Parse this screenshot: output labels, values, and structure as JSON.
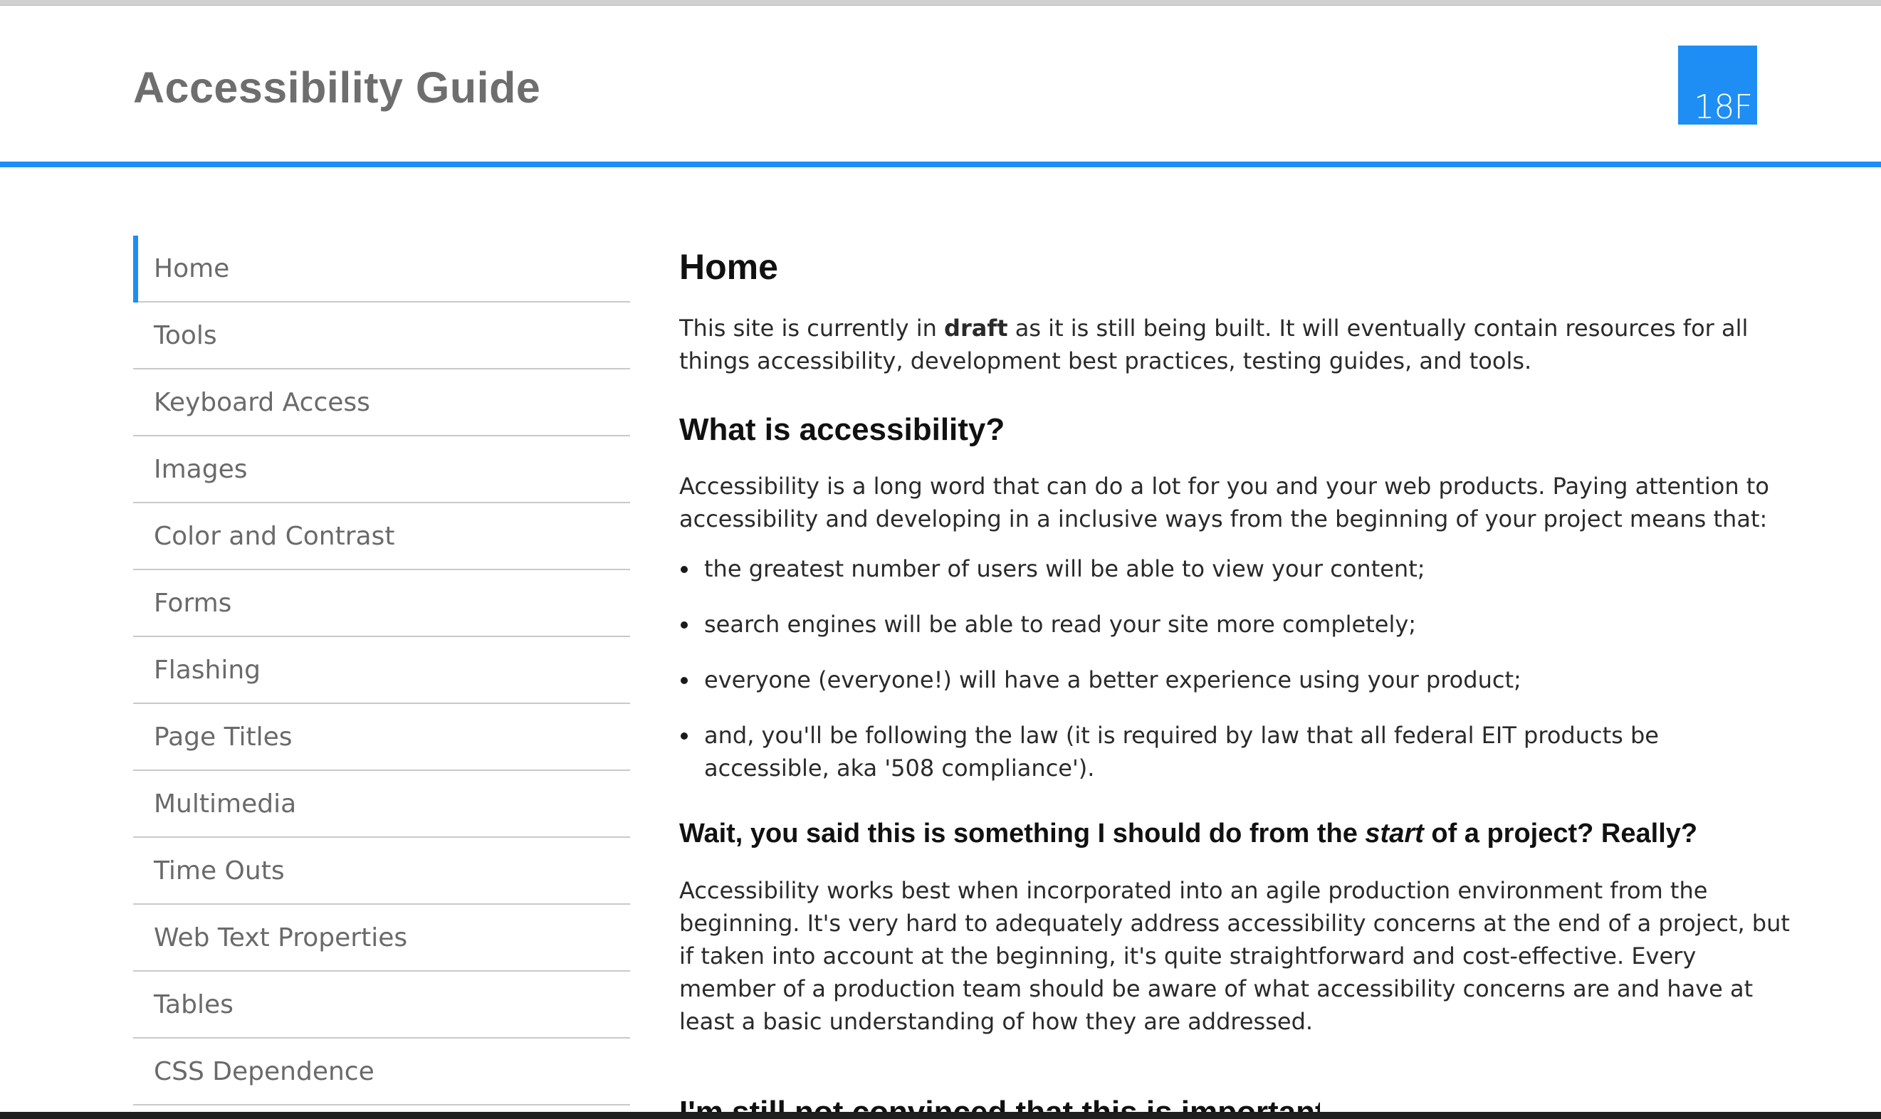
{
  "header": {
    "site_title": "Accessibility Guide",
    "logo_text": "18F",
    "accent_color": "#1e8ef5"
  },
  "sidebar": {
    "items": [
      {
        "label": "Home",
        "active": true
      },
      {
        "label": "Tools"
      },
      {
        "label": "Keyboard Access"
      },
      {
        "label": "Images"
      },
      {
        "label": "Color and Contrast"
      },
      {
        "label": "Forms"
      },
      {
        "label": "Flashing"
      },
      {
        "label": "Page Titles"
      },
      {
        "label": "Multimedia"
      },
      {
        "label": "Time Outs"
      },
      {
        "label": "Web Text Properties"
      },
      {
        "label": "Tables"
      },
      {
        "label": "CSS Dependence"
      }
    ]
  },
  "main": {
    "title": "Home",
    "intro": {
      "before": "This site is currently in ",
      "bold": "draft",
      "after": " as it is still being built. It will eventually contain resources for all things accessibility, development best practices, testing guides, and tools."
    },
    "section1": {
      "heading": "What is accessibility?",
      "paragraph": "Accessibility is a long word that can do a lot for you and your web products. Paying attention to accessibility and developing in a inclusive ways from the beginning of your project means that:",
      "bullets": [
        "the greatest number of users will be able to view your content;",
        "search engines will be able to read your site more completely;",
        "everyone (everyone!) will have a better experience using your product;",
        "and, you'll be following the law (it is required by law that all federal EIT products be accessible, aka '508 compliance')."
      ]
    },
    "section2": {
      "heading_before": "Wait, you said this is something I should do from the ",
      "heading_em": "start",
      "heading_after": " of a project? Really?",
      "paragraph": "Accessibility works best when incorporated into an agile production environment from the beginning. It's very hard to adequately address accessibility concerns at the end of a project, but if taken into account at the beginning, it's quite straightforward and cost-effective. Every member of a production team should be aware of what accessibility concerns are and have at least a basic understanding of how they are addressed."
    },
    "section3": {
      "heading_partial": "I'm still not convinced that this is important."
    }
  }
}
